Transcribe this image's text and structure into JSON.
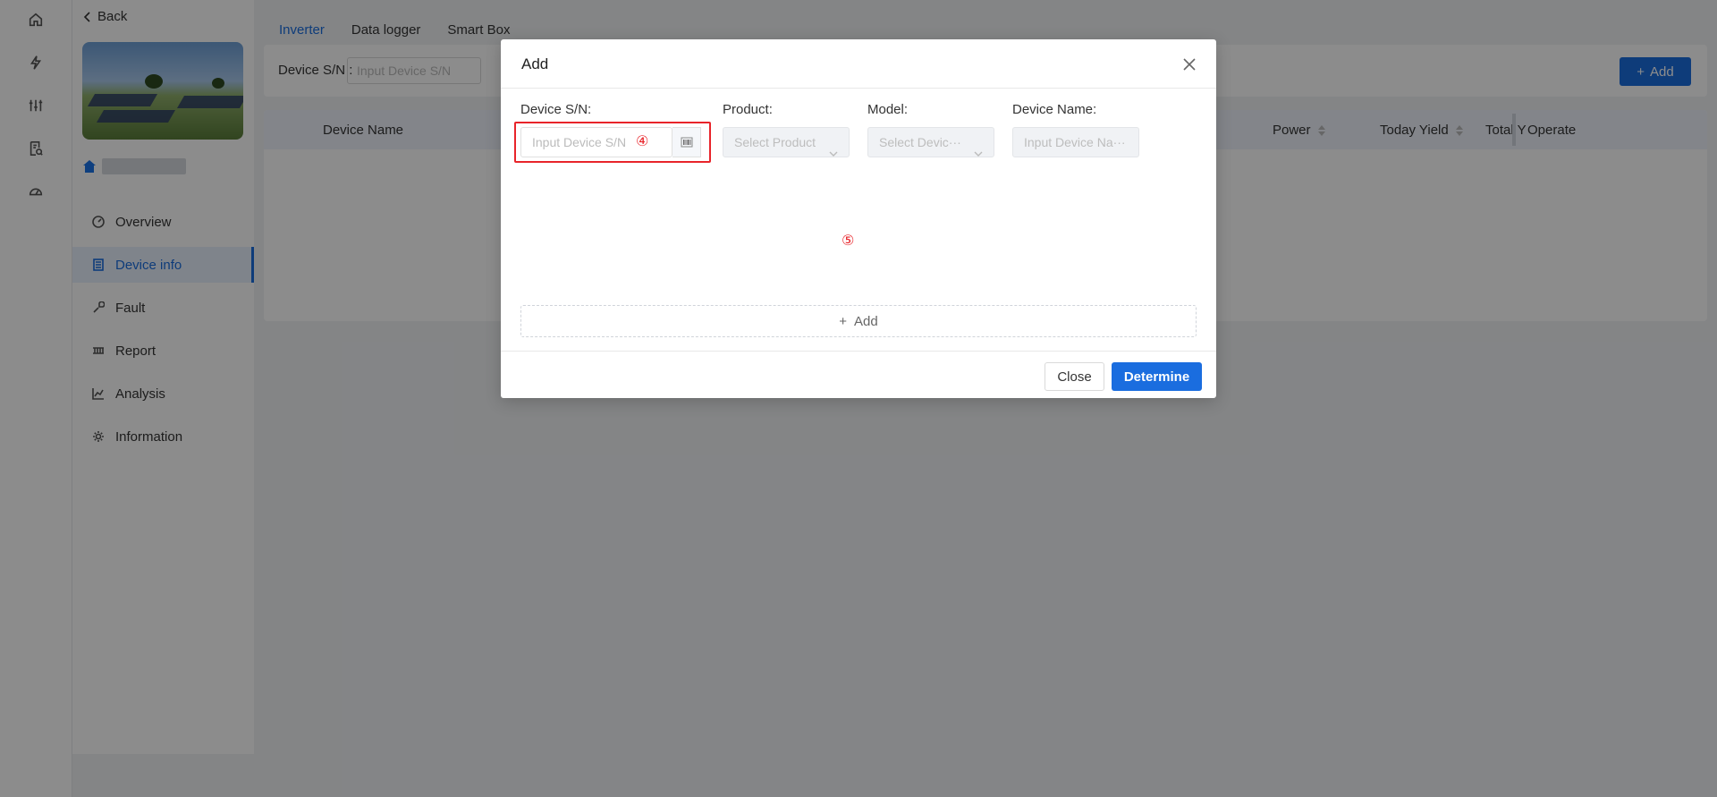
{
  "rail": {
    "icons": [
      "home-icon",
      "lightning-icon",
      "sliders-icon",
      "report-search-icon",
      "dashboard-icon"
    ]
  },
  "subnav": {
    "back_label": "Back",
    "items": [
      {
        "label": "Overview",
        "icon": "dashboard-icon"
      },
      {
        "label": "Device info",
        "icon": "document-icon",
        "active": true
      },
      {
        "label": "Fault",
        "icon": "wrench-icon"
      },
      {
        "label": "Report",
        "icon": "report-icon"
      },
      {
        "label": "Analysis",
        "icon": "line-chart-icon"
      },
      {
        "label": "Information",
        "icon": "gear-icon"
      }
    ]
  },
  "main": {
    "tabs": [
      {
        "label": "Inverter",
        "active": true
      },
      {
        "label": "Data logger"
      },
      {
        "label": "Smart Box"
      }
    ],
    "filter": {
      "sn_label": "Device S/N :",
      "sn_placeholder": "Input Device S/N"
    },
    "add_label": "Add",
    "table": {
      "columns": [
        "Device Name",
        "Power",
        "Today Yield",
        "Total Y",
        "Operate"
      ]
    }
  },
  "modal": {
    "title": "Add",
    "labels": {
      "sn": "Device S/N:",
      "product": "Product:",
      "model": "Model:",
      "name": "Device Name:"
    },
    "sn_placeholder": "Input Device S/N",
    "product_placeholder": "Select Product",
    "model_placeholder": "Select Devic···",
    "name_placeholder": "Input Device Na···",
    "markers": [
      "④",
      "⑤"
    ],
    "add_row_label": "Add",
    "close_label": "Close",
    "determine_label": "Determine"
  },
  "colors": {
    "primary": "#1a6ddf",
    "highlight": "#e8242a",
    "overlay": "rgba(0,0,0,0.45)"
  }
}
